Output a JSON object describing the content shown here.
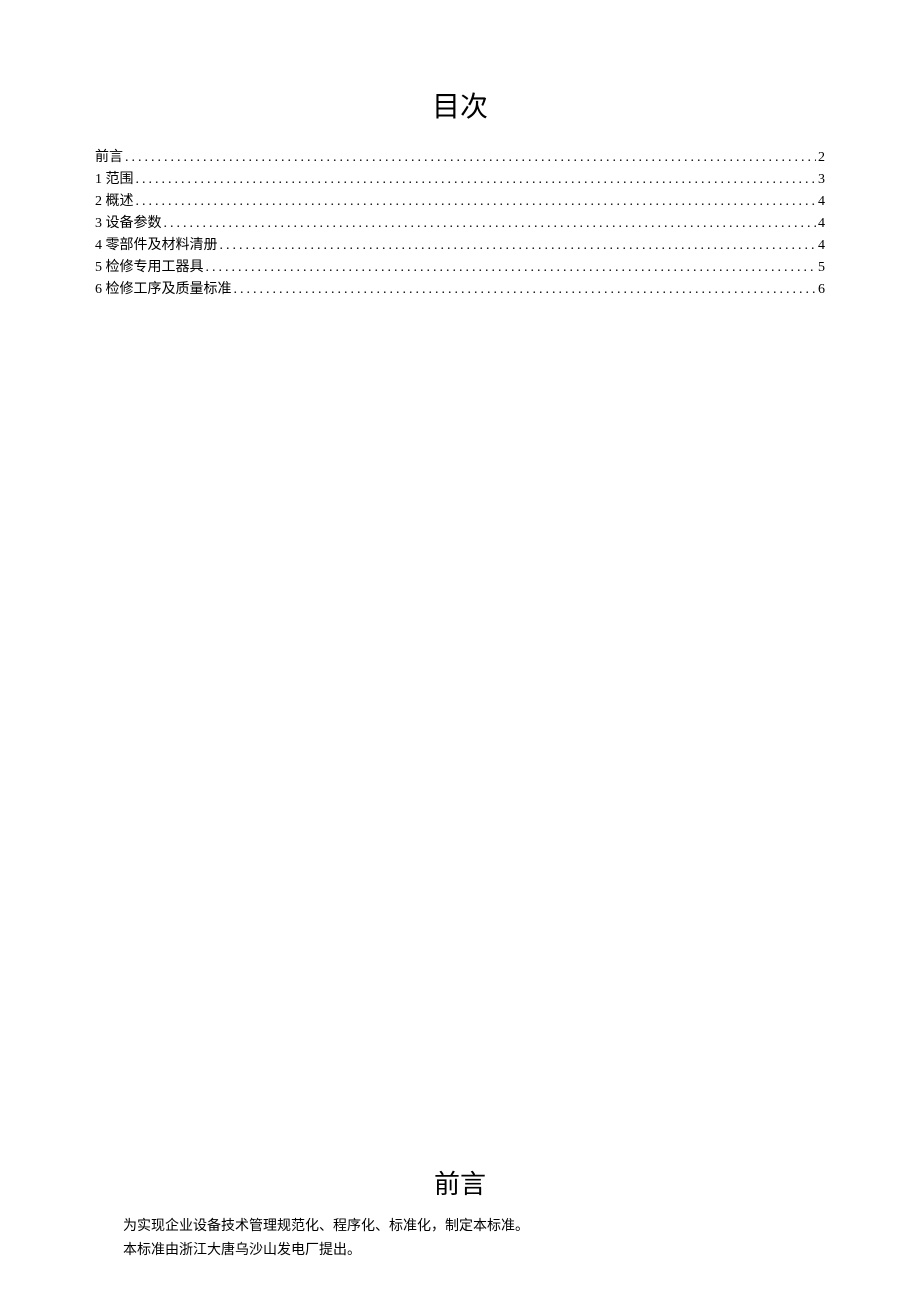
{
  "toc": {
    "title": "目次",
    "entries": [
      {
        "label": "前言",
        "page": "2"
      },
      {
        "label": "1 范围",
        "page": "3"
      },
      {
        "label": "2 概述",
        "page": "4"
      },
      {
        "label": "3 设备参数",
        "page": "4"
      },
      {
        "label": "4 零部件及材料清册",
        "page": "4"
      },
      {
        "label": "5 检修专用工器具",
        "page": "5"
      },
      {
        "label": "6 检修工序及质量标准",
        "page": "6"
      }
    ]
  },
  "preface": {
    "title": "前言",
    "paragraphs": [
      "为实现企业设备技术管理规范化、程序化、标准化，制定本标准。",
      "本标准由浙江大唐乌沙山发电厂提出。"
    ]
  }
}
